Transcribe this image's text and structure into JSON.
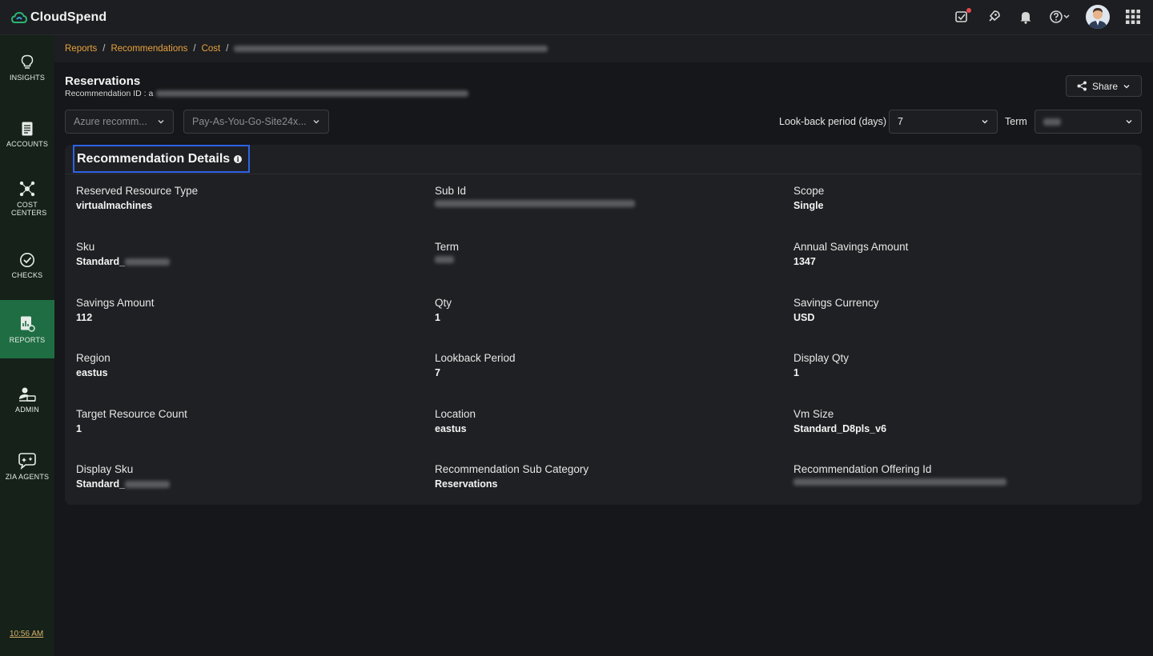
{
  "app": {
    "name": "CloudSpend",
    "accent": "#2bb673"
  },
  "topbar": {
    "icons": [
      "announcement-icon",
      "rocket-icon",
      "bell-icon",
      "help-icon",
      "avatar",
      "app-grid-icon"
    ]
  },
  "sidebar": {
    "items": [
      {
        "label": "INSIGHTS",
        "icon": "lightbulb-icon"
      },
      {
        "label": "ACCOUNTS",
        "icon": "document-icon"
      },
      {
        "label": "COST CENTERS",
        "icon": "network-icon"
      },
      {
        "label": "CHECKS",
        "icon": "check-circle-icon"
      },
      {
        "label": "REPORTS",
        "icon": "report-icon",
        "active": true
      },
      {
        "label": "ADMIN",
        "icon": "admin-icon"
      },
      {
        "label": "ZIA AGENTS",
        "icon": "agent-icon"
      }
    ],
    "time": "10:56 AM"
  },
  "breadcrumb": {
    "items": [
      "Reports",
      "Recommendations",
      "Cost"
    ],
    "separator": "/"
  },
  "header": {
    "title": "Reservations",
    "rec_id_label": "Recommendation ID : a",
    "share_label": "Share"
  },
  "filters": {
    "account": "Azure recomm...",
    "subscription": "Pay-As-You-Go-Site24x...",
    "lookback_label": "Look-back period (days)",
    "lookback_value": "7",
    "term_label": "Term"
  },
  "card": {
    "title": "Recommendation Details",
    "fields": [
      {
        "label": "Reserved Resource Type",
        "value": "virtualmachines"
      },
      {
        "label": "Sub Id",
        "value": ""
      },
      {
        "label": "Scope",
        "value": "Single"
      },
      {
        "label": "Sku",
        "value": "Standard_"
      },
      {
        "label": "Term",
        "value": ""
      },
      {
        "label": "Annual Savings Amount",
        "value": "1347"
      },
      {
        "label": "Savings Amount",
        "value": "112"
      },
      {
        "label": "Qty",
        "value": "1"
      },
      {
        "label": "Savings Currency",
        "value": "USD"
      },
      {
        "label": "Region",
        "value": "eastus"
      },
      {
        "label": "Lookback Period",
        "value": "7"
      },
      {
        "label": "Display Qty",
        "value": "1"
      },
      {
        "label": "Target Resource Count",
        "value": "1"
      },
      {
        "label": "Location",
        "value": "eastus"
      },
      {
        "label": "Vm Size",
        "value": "Standard_D8pls_v6"
      },
      {
        "label": "Display Sku",
        "value": "Standard_"
      },
      {
        "label": "Recommendation Sub Category",
        "value": "Reservations"
      },
      {
        "label": "Recommendation Offering Id",
        "value": ""
      }
    ]
  }
}
